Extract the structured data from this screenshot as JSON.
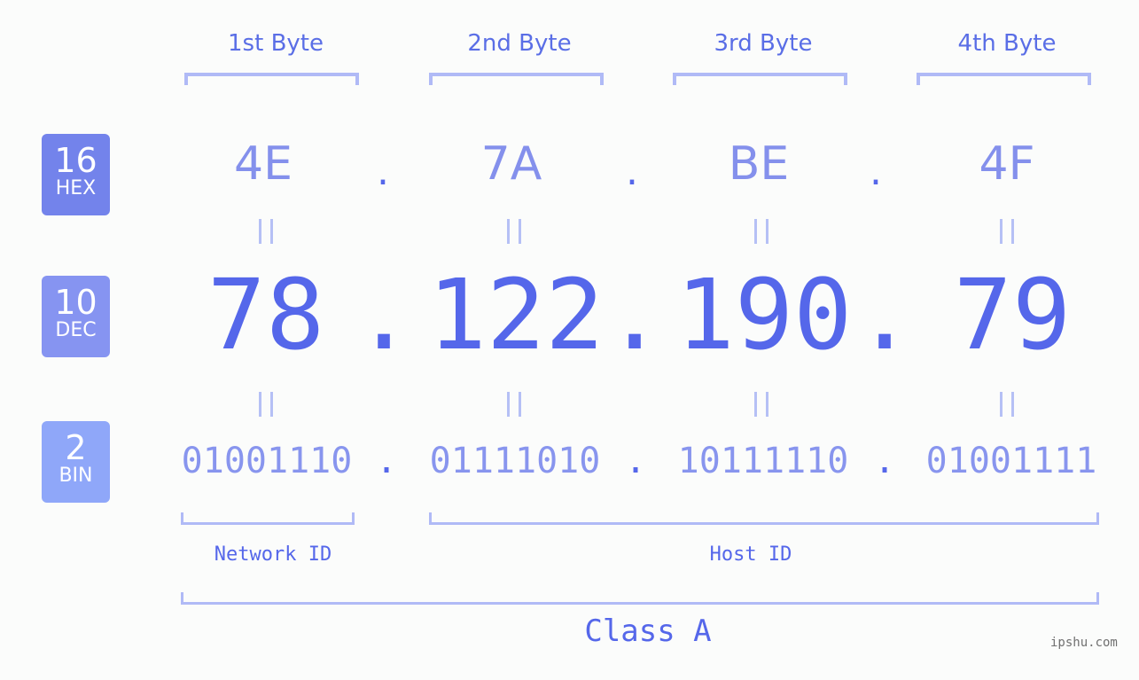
{
  "headers": [
    "1st Byte",
    "2nd Byte",
    "3rd Byte",
    "4th Byte"
  ],
  "badges": [
    {
      "num": "16",
      "label": "HEX",
      "color": "#7383eb"
    },
    {
      "num": "10",
      "label": "DEC",
      "color": "#8694f1"
    },
    {
      "num": "2",
      "label": "BIN",
      "color": "#8fa7f9"
    }
  ],
  "hex": [
    "4E",
    "7A",
    "BE",
    "4F"
  ],
  "dec": [
    "78",
    "122",
    "190",
    "79"
  ],
  "bin": [
    "01001110",
    "01111010",
    "10111110",
    "01001111"
  ],
  "separator": ".",
  "network_label": "Network ID",
  "host_label": "Host ID",
  "class_label": "Class A",
  "watermark": "ipshu.com",
  "colors": {
    "accent": "#5567ea",
    "bracket": "#b0baf6",
    "background": "#fbfcfb"
  }
}
